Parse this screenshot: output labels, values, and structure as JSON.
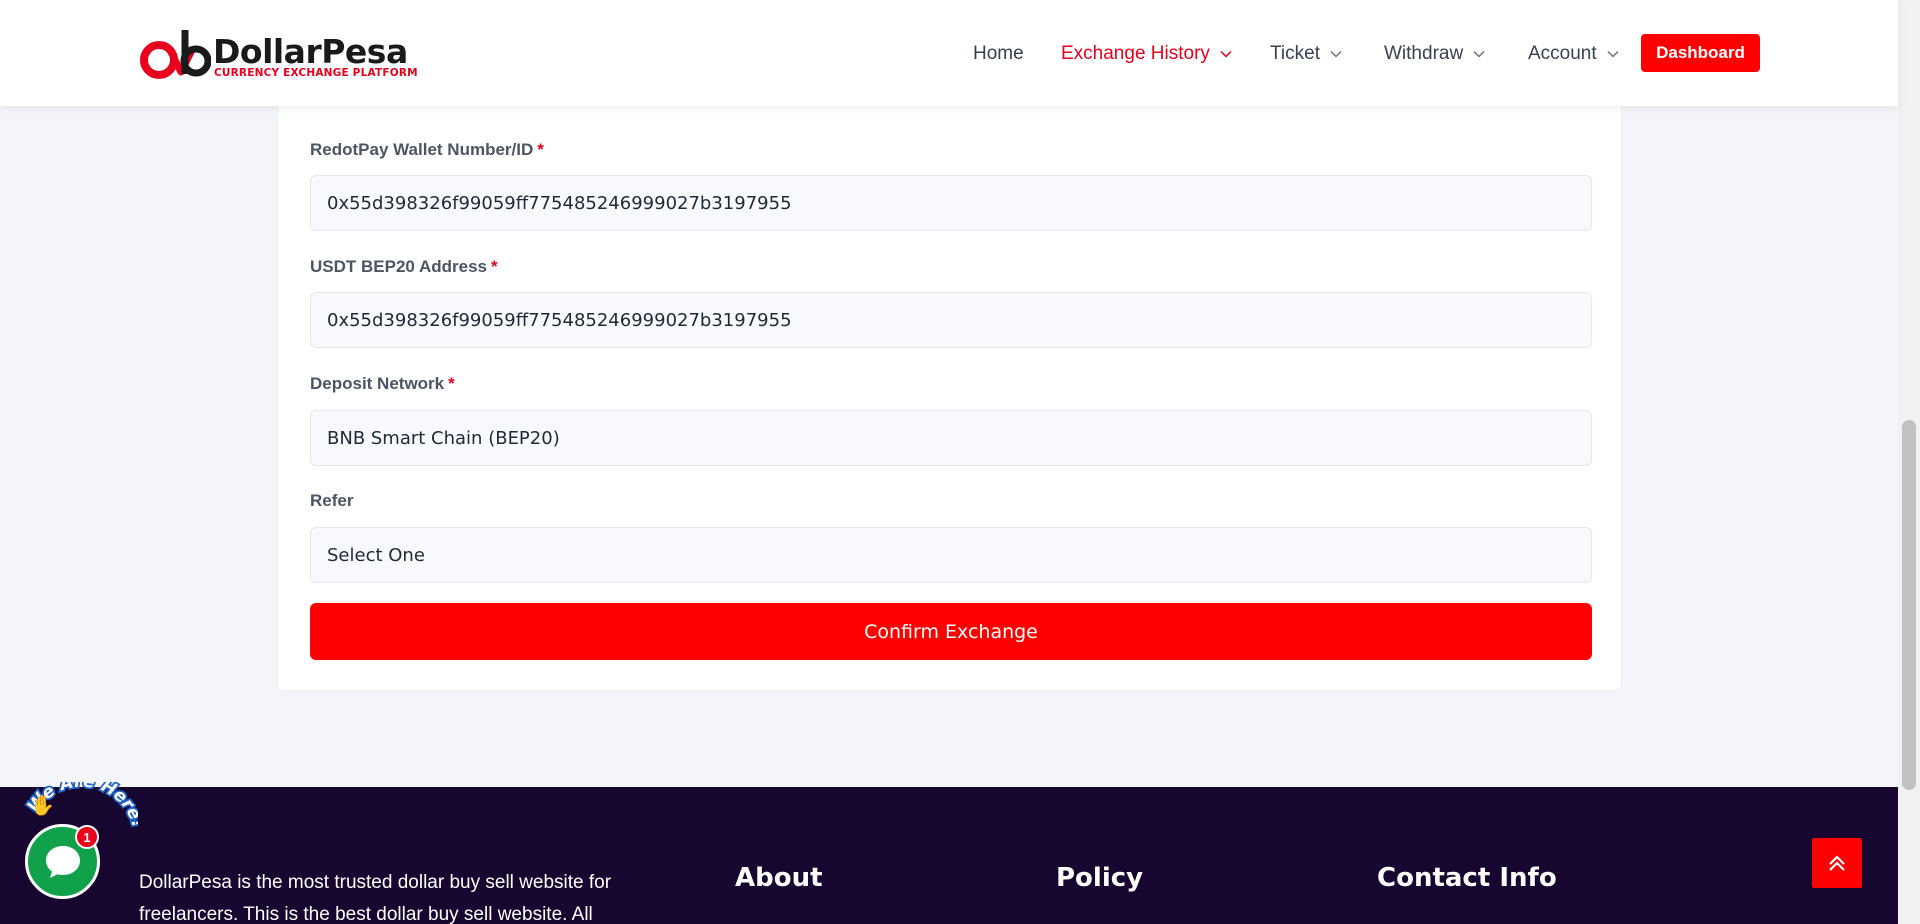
{
  "header": {
    "logo": {
      "name": "DollarPesa",
      "tagline": "CURRENCY EXCHANGE PLATFORM"
    },
    "nav": [
      {
        "label": "Home",
        "has_dropdown": false,
        "active": false
      },
      {
        "label": "Exchange History",
        "has_dropdown": true,
        "active": true
      },
      {
        "label": "Ticket",
        "has_dropdown": true,
        "active": false
      },
      {
        "label": "Withdraw",
        "has_dropdown": true,
        "active": false
      },
      {
        "label": "Account",
        "has_dropdown": true,
        "active": false
      }
    ],
    "dashboard_label": "Dashboard"
  },
  "form": {
    "fields": [
      {
        "label": "RedotPay Wallet Number/ID",
        "required": true,
        "value": "0x55d398326f99059ff775485246999027b3197955"
      },
      {
        "label": "USDT BEP20 Address",
        "required": true,
        "value": "0x55d398326f99059ff775485246999027b3197955"
      },
      {
        "label": "Deposit Network",
        "required": true,
        "value": "BNB Smart Chain (BEP20)"
      },
      {
        "label": "Refer",
        "required": false,
        "value": "Select One"
      }
    ],
    "required_marker": "*",
    "confirm_label": "Confirm Exchange"
  },
  "footer": {
    "description": "DollarPesa is the most trusted dollar buy sell website for freelancers. This is the best dollar buy sell website. All orders",
    "headings": [
      "About",
      "Policy",
      "Contact Info"
    ]
  },
  "chat": {
    "badge_count": "1",
    "curved_text": "We Are Here!"
  },
  "colors": {
    "accent": "#ff0000",
    "footer_bg": "#160630",
    "chat_green": "#10a14a"
  }
}
